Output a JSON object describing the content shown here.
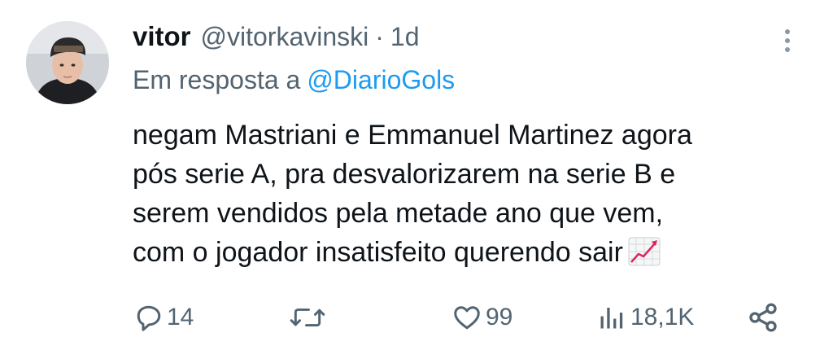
{
  "tweet": {
    "display_name": "vitor",
    "handle": "@vitorkavinski",
    "separator": "·",
    "time": "1d",
    "reply_prefix": "Em resposta a",
    "reply_mention": "@DiarioGols",
    "text_lines": [
      "negam Mastriani e Emmanuel Martinez agora",
      "pós serie A, pra desvalorizarem na serie B e",
      "serem vendidos pela metade ano que vem,",
      "com o jogador insatisfeito querendo sair"
    ],
    "emoji": "chart-increasing-icon"
  },
  "actions": {
    "replies": "14",
    "retweets": "",
    "likes": "99",
    "views": "18,1K"
  },
  "colors": {
    "text": "#0f1419",
    "secondary": "#536471",
    "link": "#1d9bf0"
  }
}
